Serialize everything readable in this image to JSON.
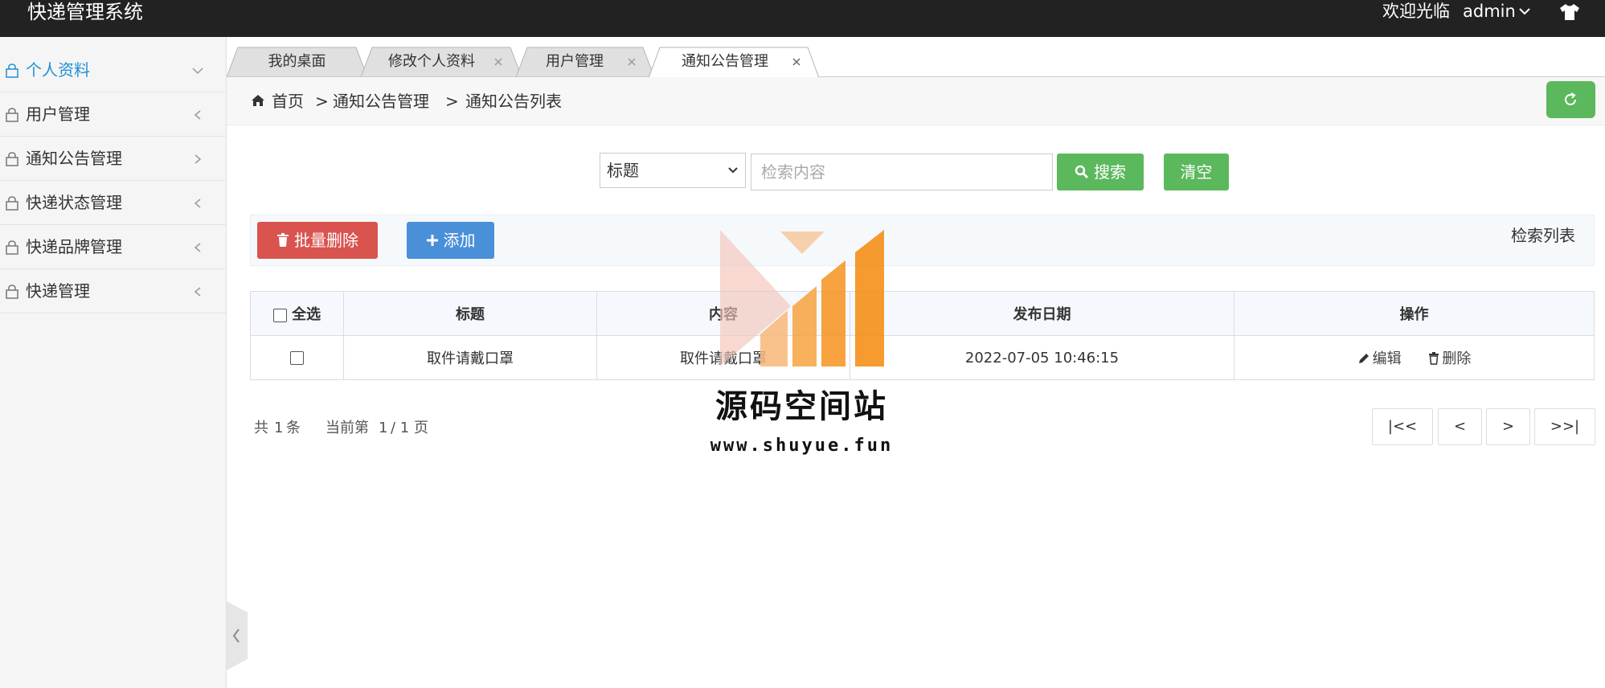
{
  "app": {
    "title": "快递管理系统",
    "welcome": "欢迎光临",
    "user": "admin"
  },
  "sidebar": {
    "items": [
      {
        "label": "个人资料",
        "active": true
      },
      {
        "label": "用户管理"
      },
      {
        "label": "通知公告管理"
      },
      {
        "label": "快递状态管理"
      },
      {
        "label": "快递品牌管理"
      },
      {
        "label": "快递管理"
      }
    ]
  },
  "tabs": [
    {
      "label": "我的桌面",
      "closable": false
    },
    {
      "label": "修改个人资料",
      "closable": true
    },
    {
      "label": "用户管理",
      "closable": true
    },
    {
      "label": "通知公告管理",
      "closable": true,
      "active": true
    }
  ],
  "breadcrumb": {
    "home": "首页",
    "sep1": ">",
    "level1": "通知公告管理",
    "sep2": ">",
    "level2": "通知公告列表"
  },
  "search": {
    "field_selected": "标题",
    "placeholder": "检索内容",
    "search_label": "搜索",
    "clear_label": "清空"
  },
  "toolbar": {
    "batch_delete": "批量删除",
    "add": "添加",
    "right_text": "检索列表"
  },
  "table": {
    "headers": {
      "select_all": "全选",
      "title": "标题",
      "content": "内容",
      "date": "发布日期",
      "action": "操作"
    },
    "rows": [
      {
        "title": "取件请戴口罩",
        "content": "取件请戴口罩",
        "date": "2022-07-05 10:46:15",
        "edit": "编辑",
        "delete": "删除"
      }
    ]
  },
  "pagination": {
    "total_prefix": "共",
    "total": "1",
    "total_suffix": "条",
    "current_prefix": "当前第",
    "current": "1",
    "pages": "/ 1 页",
    "first": "|<<",
    "prev": "<",
    "next": ">",
    "last": ">>|"
  },
  "watermark": {
    "title": "源码空间站",
    "url": "www.shuyue.fun"
  },
  "colors": {
    "topbar": "#222222",
    "green": "#5cb85c",
    "red": "#d9534f",
    "blue": "#4a90d9",
    "active_menu": "#1e8fd6",
    "watermark_orange": "#f7931e"
  }
}
